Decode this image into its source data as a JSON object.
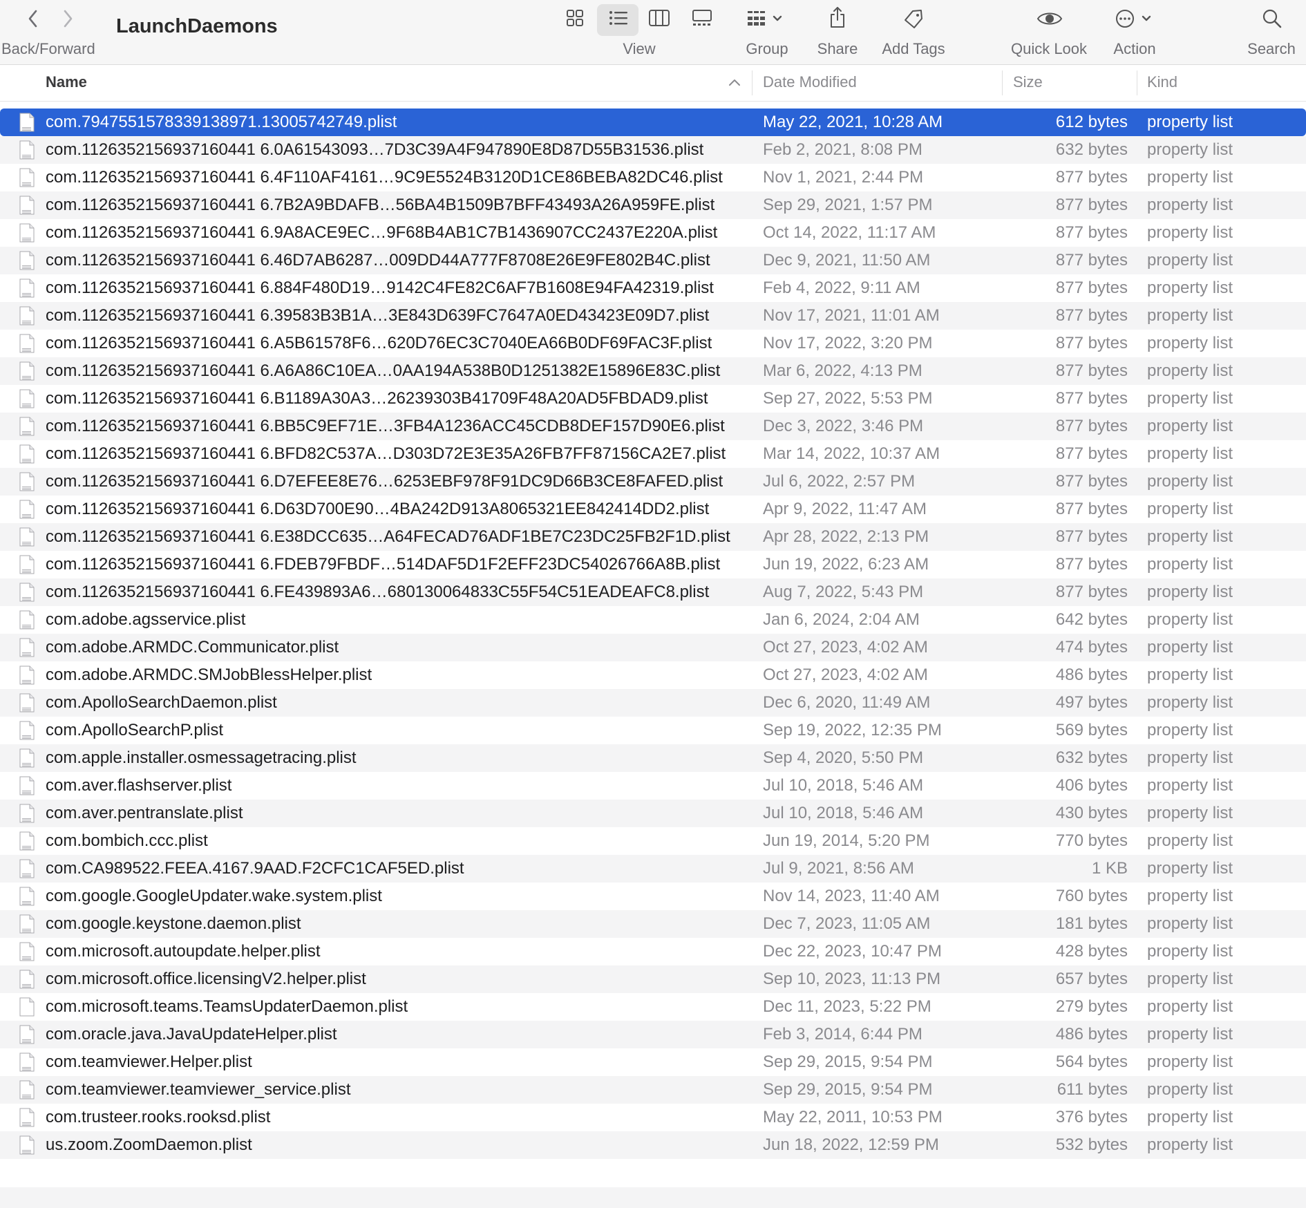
{
  "window": {
    "title": "LaunchDaemons"
  },
  "toolbar": {
    "back_forward_label": "Back/Forward",
    "view_label": "View",
    "group_label": "Group",
    "share_label": "Share",
    "add_tags_label": "Add Tags",
    "quick_look_label": "Quick Look",
    "action_label": "Action",
    "search_label": "Search",
    "selected_view": "list"
  },
  "columns": {
    "name": "Name",
    "date_modified": "Date Modified",
    "size": "Size",
    "kind": "Kind",
    "sort_column": "Name",
    "sort_direction": "ascending"
  },
  "colors": {
    "selection": "#2a63d6"
  },
  "files": [
    {
      "name": "com.7947551578339138971.13005742749.plist",
      "date": "May 22, 2021, 10:28 AM",
      "size": "612 bytes",
      "kind": "property list",
      "selected": true
    },
    {
      "name": "com.1126352156937160441 6.0A61543093…7D3C39A4F947890E8D87D55B31536.plist",
      "date": "Feb 2, 2021, 8:08 PM",
      "size": "632 bytes",
      "kind": "property list"
    },
    {
      "name": "com.1126352156937160441 6.4F110AF4161…9C9E5524B3120D1CE86BEBA82DC46.plist",
      "date": "Nov 1, 2021, 2:44 PM",
      "size": "877 bytes",
      "kind": "property list"
    },
    {
      "name": "com.1126352156937160441 6.7B2A9BDAFB…56BA4B1509B7BFF43493A26A959FE.plist",
      "date": "Sep 29, 2021, 1:57 PM",
      "size": "877 bytes",
      "kind": "property list"
    },
    {
      "name": "com.1126352156937160441 6.9A8ACE9EC…9F68B4AB1C7B1436907CC2437E220A.plist",
      "date": "Oct 14, 2022, 11:17 AM",
      "size": "877 bytes",
      "kind": "property list"
    },
    {
      "name": "com.1126352156937160441 6.46D7AB6287…009DD44A777F8708E26E9FE802B4C.plist",
      "date": "Dec 9, 2021, 11:50 AM",
      "size": "877 bytes",
      "kind": "property list"
    },
    {
      "name": "com.1126352156937160441 6.884F480D19…9142C4FE82C6AF7B1608E94FA42319.plist",
      "date": "Feb 4, 2022, 9:11 AM",
      "size": "877 bytes",
      "kind": "property list"
    },
    {
      "name": "com.1126352156937160441 6.39583B3B1A…3E843D639FC7647A0ED43423E09D7.plist",
      "date": "Nov 17, 2021, 11:01 AM",
      "size": "877 bytes",
      "kind": "property list"
    },
    {
      "name": "com.1126352156937160441 6.A5B61578F6…620D76EC3C7040EA66B0DF69FAC3F.plist",
      "date": "Nov 17, 2022, 3:20 PM",
      "size": "877 bytes",
      "kind": "property list"
    },
    {
      "name": "com.1126352156937160441 6.A6A86C10EA…0AA194A538B0D1251382E15896E83C.plist",
      "date": "Mar 6, 2022, 4:13 PM",
      "size": "877 bytes",
      "kind": "property list"
    },
    {
      "name": "com.1126352156937160441 6.B1189A30A3…26239303B41709F48A20AD5FBDAD9.plist",
      "date": "Sep 27, 2022, 5:53 PM",
      "size": "877 bytes",
      "kind": "property list"
    },
    {
      "name": "com.1126352156937160441 6.BB5C9EF71E…3FB4A1236ACC45CDB8DEF157D90E6.plist",
      "date": "Dec 3, 2022, 3:46 PM",
      "size": "877 bytes",
      "kind": "property list"
    },
    {
      "name": "com.1126352156937160441 6.BFD82C537A…D303D72E3E35A26FB7FF87156CA2E7.plist",
      "date": "Mar 14, 2022, 10:37 AM",
      "size": "877 bytes",
      "kind": "property list"
    },
    {
      "name": "com.1126352156937160441 6.D7EFEE8E76…6253EBF978F91DC9D66B3CE8FAFED.plist",
      "date": "Jul 6, 2022, 2:57 PM",
      "size": "877 bytes",
      "kind": "property list"
    },
    {
      "name": "com.1126352156937160441 6.D63D700E90…4BA242D913A8065321EE842414DD2.plist",
      "date": "Apr 9, 2022, 11:47 AM",
      "size": "877 bytes",
      "kind": "property list"
    },
    {
      "name": "com.1126352156937160441 6.E38DCC635…A64FECAD76ADF1BE7C23DC25FB2F1D.plist",
      "date": "Apr 28, 2022, 2:13 PM",
      "size": "877 bytes",
      "kind": "property list"
    },
    {
      "name": "com.1126352156937160441 6.FDEB79FBDF…514DAF5D1F2EFF23DC54026766A8B.plist",
      "date": "Jun 19, 2022, 6:23 AM",
      "size": "877 bytes",
      "kind": "property list"
    },
    {
      "name": "com.1126352156937160441 6.FE439893A6…680130064833C55F54C51EADEAFC8.plist",
      "date": "Aug 7, 2022, 5:43 PM",
      "size": "877 bytes",
      "kind": "property list"
    },
    {
      "name": "com.adobe.agsservice.plist",
      "date": "Jan 6, 2024, 2:04 AM",
      "size": "642 bytes",
      "kind": "property list"
    },
    {
      "name": "com.adobe.ARMDC.Communicator.plist",
      "date": "Oct 27, 2023, 4:02 AM",
      "size": "474 bytes",
      "kind": "property list"
    },
    {
      "name": "com.adobe.ARMDC.SMJobBlessHelper.plist",
      "date": "Oct 27, 2023, 4:02 AM",
      "size": "486 bytes",
      "kind": "property list"
    },
    {
      "name": "com.ApolloSearchDaemon.plist",
      "date": "Dec 6, 2020, 11:49 AM",
      "size": "497 bytes",
      "kind": "property list"
    },
    {
      "name": "com.ApolloSearchP.plist",
      "date": "Sep 19, 2022, 12:35 PM",
      "size": "569 bytes",
      "kind": "property list"
    },
    {
      "name": "com.apple.installer.osmessagetracing.plist",
      "date": "Sep 4, 2020, 5:50 PM",
      "size": "632 bytes",
      "kind": "property list"
    },
    {
      "name": "com.aver.flashserver.plist",
      "date": "Jul 10, 2018, 5:46 AM",
      "size": "406 bytes",
      "kind": "property list"
    },
    {
      "name": "com.aver.pentranslate.plist",
      "date": "Jul 10, 2018, 5:46 AM",
      "size": "430 bytes",
      "kind": "property list"
    },
    {
      "name": "com.bombich.ccc.plist",
      "date": "Jun 19, 2014, 5:20 PM",
      "size": "770 bytes",
      "kind": "property list"
    },
    {
      "name": "com.CA989522.FEEA.4167.9AAD.F2CFC1CAF5ED.plist",
      "date": "Jul 9, 2021, 8:56 AM",
      "size": "1 KB",
      "kind": "property list"
    },
    {
      "name": "com.google.GoogleUpdater.wake.system.plist",
      "date": "Nov 14, 2023, 11:40 AM",
      "size": "760 bytes",
      "kind": "property list"
    },
    {
      "name": "com.google.keystone.daemon.plist",
      "date": "Dec 7, 2023, 11:05 AM",
      "size": "181 bytes",
      "kind": "property list"
    },
    {
      "name": "com.microsoft.autoupdate.helper.plist",
      "date": "Dec 22, 2023, 10:47 PM",
      "size": "428 bytes",
      "kind": "property list"
    },
    {
      "name": "com.microsoft.office.licensingV2.helper.plist",
      "date": "Sep 10, 2023, 11:13 PM",
      "size": "657 bytes",
      "kind": "property list"
    },
    {
      "name": "com.microsoft.teams.TeamsUpdaterDaemon.plist",
      "date": "Dec 11, 2023, 5:22 PM",
      "size": "279 bytes",
      "kind": "property list",
      "blank_icon": true
    },
    {
      "name": "com.oracle.java.JavaUpdateHelper.plist",
      "date": "Feb 3, 2014, 6:44 PM",
      "size": "486 bytes",
      "kind": "property list"
    },
    {
      "name": "com.teamviewer.Helper.plist",
      "date": "Sep 29, 2015, 9:54 PM",
      "size": "564 bytes",
      "kind": "property list"
    },
    {
      "name": "com.teamviewer.teamviewer_service.plist",
      "date": "Sep 29, 2015, 9:54 PM",
      "size": "611 bytes",
      "kind": "property list"
    },
    {
      "name": "com.trusteer.rooks.rooksd.plist",
      "date": "May 22, 2011, 10:53 PM",
      "size": "376 bytes",
      "kind": "property list"
    },
    {
      "name": "us.zoom.ZoomDaemon.plist",
      "date": "Jun 18, 2022, 12:59 PM",
      "size": "532 bytes",
      "kind": "property list"
    }
  ]
}
